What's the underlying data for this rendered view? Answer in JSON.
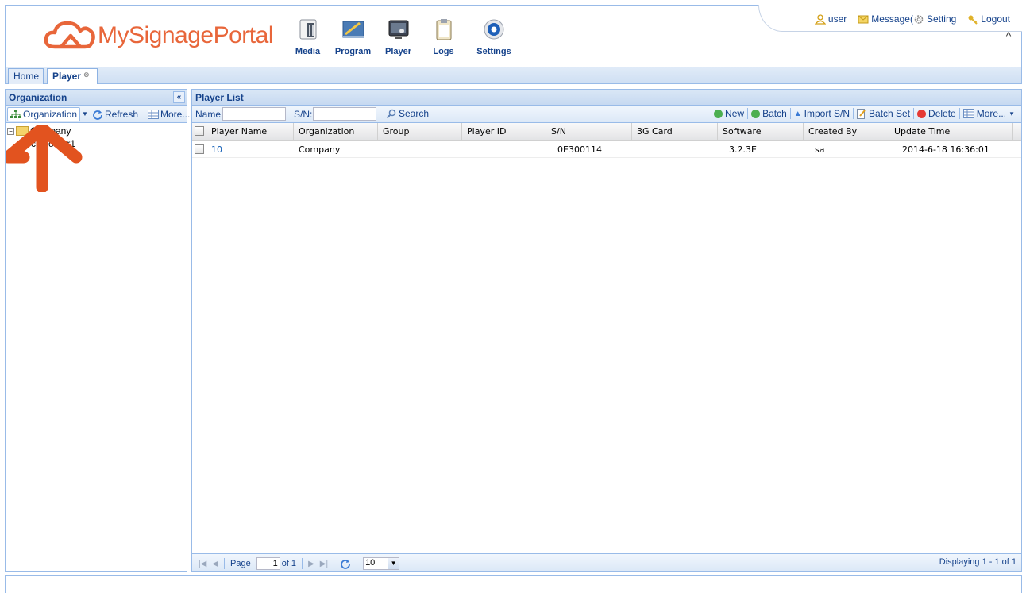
{
  "brand": {
    "logo_text_my": "My",
    "logo_text_signage": "Signage",
    "logo_text_portal": "Portal"
  },
  "topnav": [
    {
      "label": "Media"
    },
    {
      "label": "Program"
    },
    {
      "label": "Player"
    },
    {
      "label": "Logs"
    },
    {
      "label": "Settings"
    }
  ],
  "toplinks": {
    "user": "user",
    "message": "Message(",
    "setting": "Setting",
    "logout": "Logout"
  },
  "tabs": {
    "home": "Home",
    "player": "Player"
  },
  "left_panel": {
    "title": "Organization",
    "toolbar": {
      "organization": "Organization",
      "refresh": "Refresh",
      "more": "More..."
    },
    "tree": {
      "root": "Company",
      "child": "customer1"
    }
  },
  "right_panel": {
    "title": "Player List",
    "search": {
      "name_label": "Name:",
      "sn_label": "S/N:",
      "search_button": "Search",
      "name_value": "",
      "sn_value": ""
    },
    "actions": {
      "new": "New",
      "batch": "Batch",
      "import_sn": "Import S/N",
      "batch_set": "Batch Set",
      "delete": "Delete",
      "more": "More..."
    },
    "columns": [
      "Player Name",
      "Organization",
      "Group",
      "Player ID",
      "S/N",
      "3G Card",
      "Software",
      "Created By",
      "Update Time"
    ],
    "rows": [
      {
        "player_name": "10",
        "organization": "Company",
        "group": "",
        "player_id": "",
        "sn": "0E300114",
        "card": "",
        "software": "3.2.3E",
        "created_by": "sa",
        "update_time": "2014-6-18 16:36:01"
      }
    ],
    "pager": {
      "page_label": "Page",
      "page_value": "1",
      "of_label": "of 1",
      "page_size": "10",
      "display_text": "Displaying 1 - 1 of 1"
    }
  },
  "colors": {
    "brand_orange": "#e8663a",
    "panel_border": "#99bbe8",
    "title_blue": "#15428b",
    "arrow": "#e2531f"
  }
}
